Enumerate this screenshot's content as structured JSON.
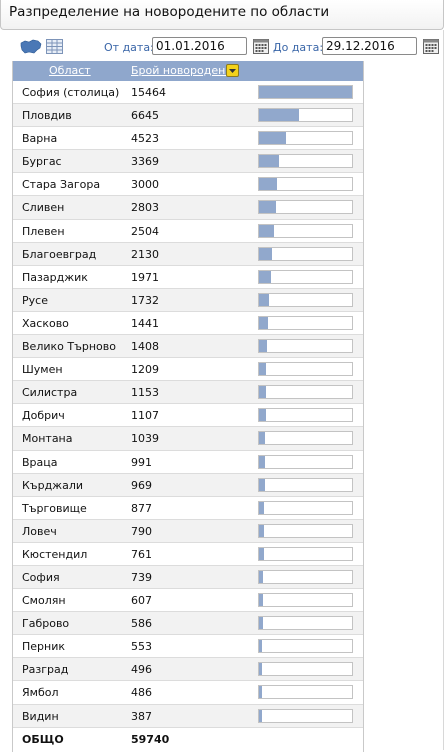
{
  "header": {
    "title": "Разпределение на новородените по области"
  },
  "filters": {
    "from_label": "От дата:",
    "from_value": "01.01.2016",
    "to_label": "До дата:",
    "to_value": "29.12.2016"
  },
  "table": {
    "col_region": "Област",
    "col_births": "Брой новородени",
    "rows": [
      {
        "region": "София (столица)",
        "count": "15464"
      },
      {
        "region": "Пловдив",
        "count": "6645"
      },
      {
        "region": "Варна",
        "count": "4523"
      },
      {
        "region": "Бургас",
        "count": "3369"
      },
      {
        "region": "Стара Загора",
        "count": "3000"
      },
      {
        "region": "Сливен",
        "count": "2803"
      },
      {
        "region": "Плевен",
        "count": "2504"
      },
      {
        "region": "Благоевград",
        "count": "2130"
      },
      {
        "region": "Пазарджик",
        "count": "1971"
      },
      {
        "region": "Русе",
        "count": "1732"
      },
      {
        "region": "Хасково",
        "count": "1441"
      },
      {
        "region": "Велико Търново",
        "count": "1408"
      },
      {
        "region": "Шумен",
        "count": "1209"
      },
      {
        "region": "Силистра",
        "count": "1153"
      },
      {
        "region": "Добрич",
        "count": "1107"
      },
      {
        "region": "Монтана",
        "count": "1039"
      },
      {
        "region": "Враца",
        "count": "991"
      },
      {
        "region": "Кърджали",
        "count": "969"
      },
      {
        "region": "Търговище",
        "count": "877"
      },
      {
        "region": "Ловеч",
        "count": "790"
      },
      {
        "region": "Кюстендил",
        "count": "761"
      },
      {
        "region": "София",
        "count": "739"
      },
      {
        "region": "Смолян",
        "count": "607"
      },
      {
        "region": "Габрово",
        "count": "586"
      },
      {
        "region": "Перник",
        "count": "553"
      },
      {
        "region": "Разград",
        "count": "496"
      },
      {
        "region": "Ямбол",
        "count": "486"
      },
      {
        "region": "Видин",
        "count": "387"
      }
    ],
    "total_label": "ОБЩО",
    "total_value": "59740"
  },
  "colors": {
    "header_bg": "#8fa7cc",
    "bar_fill": "#91a8cc",
    "label_blue": "#3a66a8",
    "sort_button": "#f3d21b"
  },
  "icons": [
    "bulgaria-map-icon",
    "table-view-icon",
    "calendar-icon",
    "sort-dropdown-icon"
  ]
}
